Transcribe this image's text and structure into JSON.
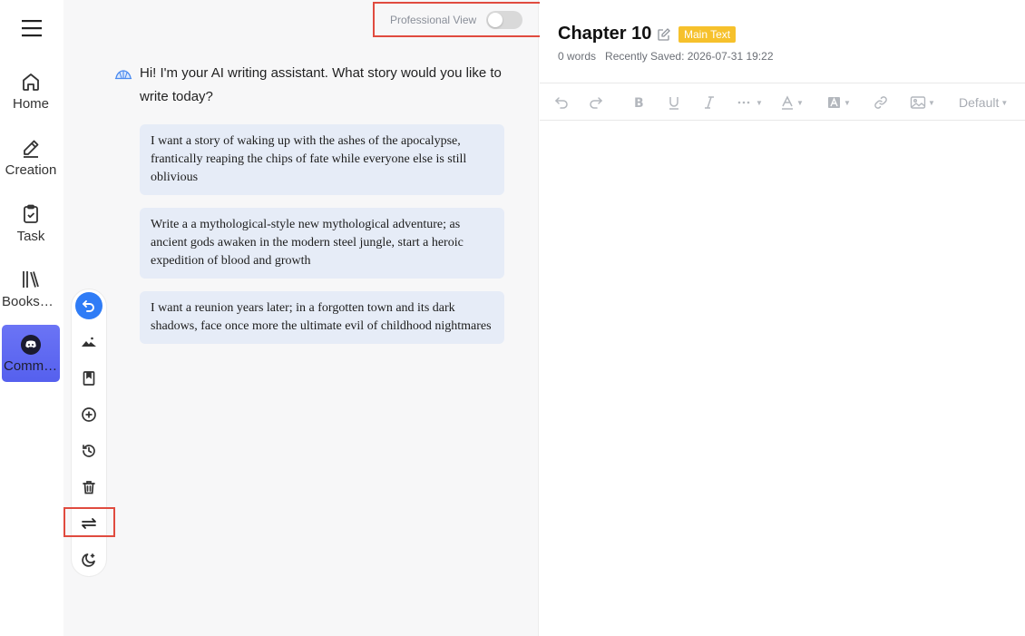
{
  "nav": {
    "items": [
      {
        "label": "Home"
      },
      {
        "label": "Creation"
      },
      {
        "label": "Task"
      },
      {
        "label": "Bookshelf"
      },
      {
        "label": "Community"
      }
    ]
  },
  "chat": {
    "professional_view_label": "Professional View",
    "professional_view_on": false,
    "greeting": "Hi! I'm your AI writing assistant. What story would you like to write today?",
    "suggestions": [
      "I want a story of waking up with the ashes of the apocalypse, frantically reaping the chips of fate while everyone else is still oblivious",
      "Write a a mythological-style new mythological adventure; as ancient gods awaken in the modern steel jungle, start a heroic expedition of blood and growth",
      "I want a reunion years later; in a forgotten town and its dark shadows, face once more the ultimate evil of childhood nightmares"
    ],
    "tools": [
      "undo-arrow-icon",
      "landscape-icon",
      "bookmark-book-icon",
      "add-circle-icon",
      "history-icon",
      "trash-icon",
      "swap-arrows-icon",
      "moon-icon"
    ]
  },
  "editor": {
    "chapter_title": "Chapter 10",
    "badge": "Main Text",
    "word_count": "0 words",
    "saved": "Recently Saved: 2026-07-31 19:22",
    "style_select": "Default"
  },
  "colors": {
    "accent": "#2f7cf6",
    "nav_active": "#5b64f0",
    "badge": "#f6c12c",
    "highlight_box": "#e04b3f",
    "suggestion_bg": "#e6ecf7"
  }
}
